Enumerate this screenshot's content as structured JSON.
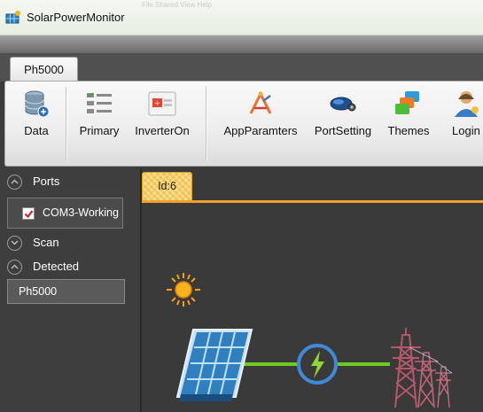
{
  "window": {
    "title": "SolarPowerMonitor",
    "ghost_text": "File  Shared  View  Help"
  },
  "ribbon": {
    "tab": "Ph5000",
    "buttons": [
      {
        "label": "Data",
        "icon": "database-icon"
      },
      {
        "label": "Primary",
        "icon": "list-icon"
      },
      {
        "label": "InverterOn",
        "icon": "inverter-icon"
      },
      {
        "label": "AppParamters",
        "icon": "tools-icon"
      },
      {
        "label": "PortSetting",
        "icon": "port-icon"
      },
      {
        "label": "Themes",
        "icon": "themes-icon"
      },
      {
        "label": "Login",
        "icon": "user-icon"
      }
    ]
  },
  "left_panel": {
    "ports_header": "Ports",
    "port_item": "COM3-Working",
    "port_checked": true,
    "scan_header": "Scan",
    "detected_header": "Detected",
    "device_item": "Ph5000"
  },
  "content": {
    "tab": "Id:6"
  },
  "colors": {
    "accent_orange": "#f0a030",
    "tab_yellow": "#f2c24a",
    "flow_green": "#6ecb1e",
    "panel_blue": "#2f7fc1",
    "tower_red": "#b5566a"
  }
}
